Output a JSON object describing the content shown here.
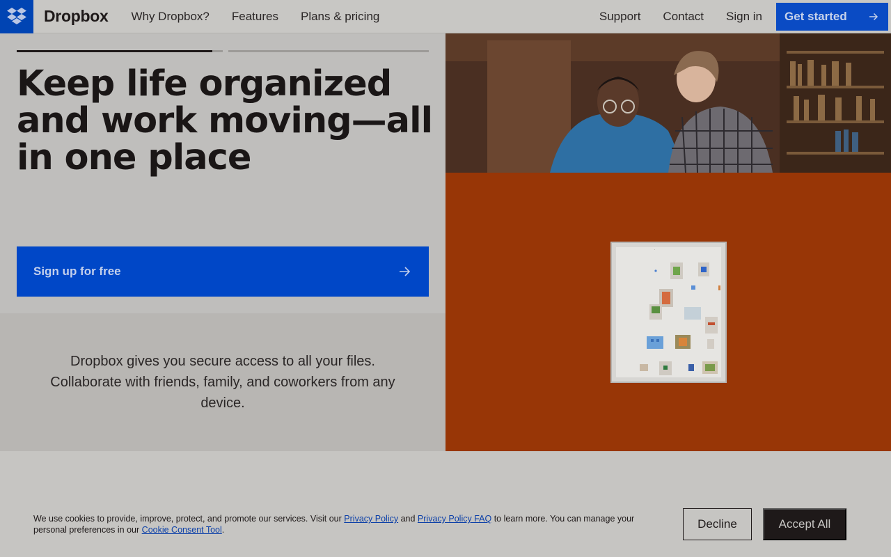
{
  "header": {
    "brand": "Dropbox",
    "nav_left": [
      "Why Dropbox?",
      "Features",
      "Plans & pricing"
    ],
    "nav_right": [
      "Support",
      "Contact",
      "Sign in"
    ],
    "cta": "Get started"
  },
  "hero": {
    "headline": "Keep life organized and work moving—all in one place",
    "signup": "Sign up for free",
    "slide_progress": 0.95,
    "description": "Dropbox gives you secure access to all your files. Collaborate with friends, family, and coworkers from any device."
  },
  "cookie": {
    "text_1": "We use cookies to provide, improve, protect, and promote our services. Visit our",
    "link_privacy": "Privacy Policy",
    "text_2": "and",
    "link_faq": "Privacy Policy FAQ",
    "text_3": "to learn more. You can manage your personal preferences in our",
    "link_tool": "Cookie Consent Tool",
    "text_4": ".",
    "decline": "Decline",
    "accept": "Accept All"
  },
  "colors": {
    "brand_blue": "#0061fe",
    "accent_orange": "#983606"
  }
}
